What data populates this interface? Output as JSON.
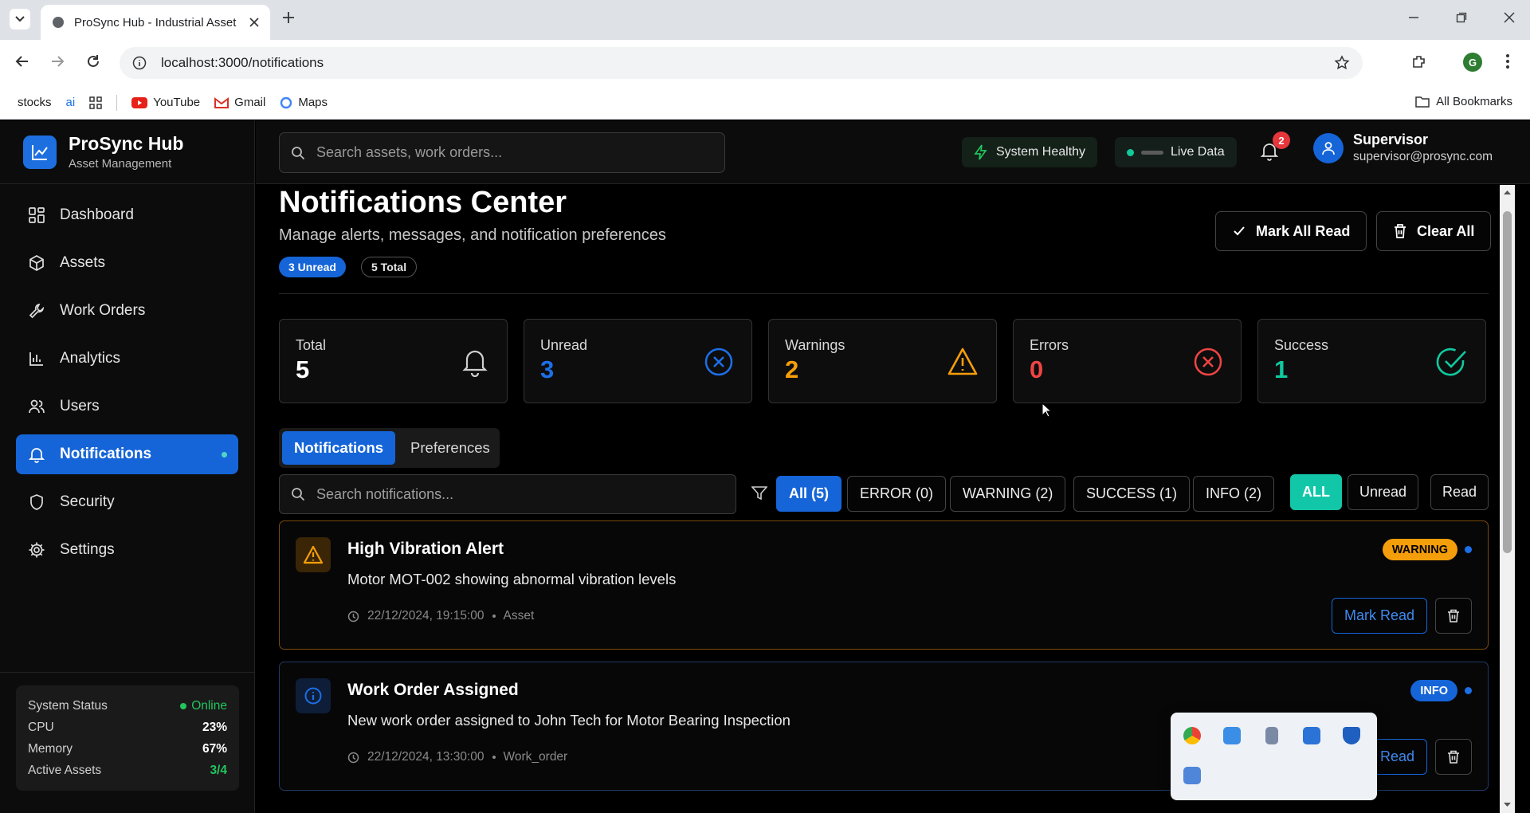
{
  "browser": {
    "tab_title": "ProSync Hub - Industrial Asset Management",
    "url": "localhost:3000/notifications",
    "profile_initial": "G",
    "bookmarks": [
      "stocks",
      "ai",
      "YouTube",
      "Gmail",
      "Maps"
    ],
    "all_bookmarks": "All Bookmarks"
  },
  "brand": {
    "name": "ProSync Hub",
    "subtitle": "Asset Management"
  },
  "sidebar": {
    "items": [
      {
        "label": "Dashboard",
        "icon": "grid-icon"
      },
      {
        "label": "Assets",
        "icon": "box-icon"
      },
      {
        "label": "Work Orders",
        "icon": "wrench-icon"
      },
      {
        "label": "Analytics",
        "icon": "bar-chart-icon"
      },
      {
        "label": "Users",
        "icon": "users-icon"
      },
      {
        "label": "Notifications",
        "icon": "bell-icon",
        "active": true
      },
      {
        "label": "Security",
        "icon": "shield-icon"
      },
      {
        "label": "Settings",
        "icon": "gear-icon"
      }
    ],
    "system": {
      "status_label": "System Status",
      "status_value": "Online",
      "cpu_label": "CPU",
      "cpu_value": "23%",
      "memory_label": "Memory",
      "memory_value": "67%",
      "assets_label": "Active Assets",
      "assets_value": "3/4"
    }
  },
  "header": {
    "search_placeholder": "Search assets, work orders...",
    "health": "System Healthy",
    "live": "Live Data",
    "notif_count": "2",
    "user_name": "Supervisor",
    "user_email": "supervisor@prosync.com"
  },
  "page": {
    "title": "Notifications Center",
    "subtitle": "Manage alerts, messages, and notification preferences",
    "unread_pill": "3 Unread",
    "total_pill": "5 Total",
    "mark_all": "Mark All Read",
    "clear_all": "Clear All"
  },
  "stats": [
    {
      "label": "Total",
      "value": "5",
      "color": "#ffffff"
    },
    {
      "label": "Unread",
      "value": "3",
      "color": "#1d6fe8"
    },
    {
      "label": "Warnings",
      "value": "2",
      "color": "#f59e0b"
    },
    {
      "label": "Errors",
      "value": "0",
      "color": "#ef4444"
    },
    {
      "label": "Success",
      "value": "1",
      "color": "#10c9a0"
    }
  ],
  "tabs": [
    "Notifications",
    "Preferences"
  ],
  "filters": {
    "search_placeholder": "Search notifications...",
    "types": [
      "All (5)",
      "ERROR (0)",
      "WARNING (2)",
      "SUCCESS (1)",
      "INFO (2)"
    ],
    "read": [
      "ALL",
      "Unread",
      "Read"
    ]
  },
  "notifications": [
    {
      "title": "High Vibration Alert",
      "message": "Motor MOT-002 showing abnormal vibration levels",
      "time": "22/12/2024, 19:15:00",
      "category": "Asset",
      "tag": "WARNING",
      "action": "Mark Read"
    },
    {
      "title": "Work Order Assigned",
      "message": "New work order assigned to John Tech for Motor Bearing Inspection",
      "time": "22/12/2024, 13:30:00",
      "category": "Work_order",
      "tag": "INFO",
      "action": "Read"
    }
  ]
}
